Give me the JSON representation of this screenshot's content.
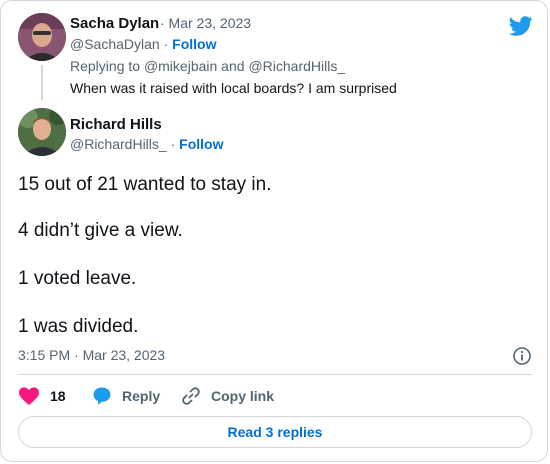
{
  "quoted_tweet": {
    "author_name": "Sacha Dylan",
    "date": " · Mar 23, 2023",
    "handle": "@SachaDylan",
    "follow_label": "Follow",
    "replying_prefix": "Replying to ",
    "replying_user1": "@mikejbain",
    "replying_and": " and ",
    "replying_user2": "@RichardHills_",
    "text": "When was it raised with local boards? I am surprised"
  },
  "tweet": {
    "author_name": "Richard Hills",
    "handle": "@RichardHills_",
    "follow_label": "Follow",
    "lines": [
      "15 out of 21 wanted to stay in.",
      "4 didn’t give a view.",
      "1 voted leave.",
      "1 was divided."
    ],
    "timestamp": "3:15 PM · Mar 23, 2023"
  },
  "actions": {
    "like_count": "18",
    "reply_label": "Reply",
    "copy_link_label": "Copy link"
  },
  "read_replies_label": "Read 3 replies",
  "colors": {
    "like": "#f91880",
    "link": "#006fd6",
    "twitter_blue": "#1d9bf0"
  }
}
